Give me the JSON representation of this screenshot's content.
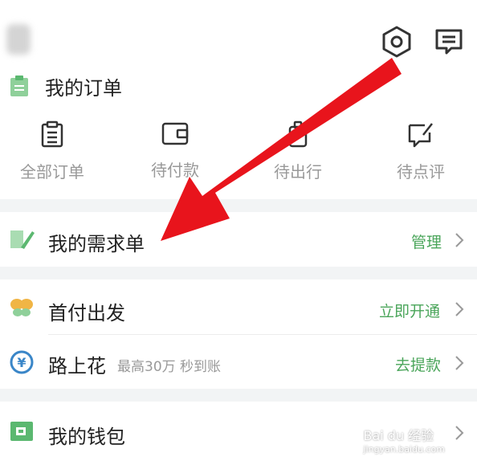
{
  "orders": {
    "title": "我的订单",
    "items": [
      {
        "label": "全部订单",
        "icon": "clipboard-icon"
      },
      {
        "label": "待付款",
        "icon": "wallet-icon"
      },
      {
        "label": "待出行",
        "icon": "luggage-icon"
      },
      {
        "label": "待点评",
        "icon": "comment-edit-icon"
      }
    ]
  },
  "demand": {
    "label": "我的需求单",
    "action": "管理"
  },
  "finance": {
    "shoufu": {
      "label": "首付出发",
      "action": "立即开通"
    },
    "lushanghua": {
      "label": "路上花",
      "subtitle": "最高30万 秒到账",
      "action": "去提款"
    }
  },
  "wallet": {
    "label": "我的钱包"
  },
  "watermark": {
    "text": "Bai du 经验",
    "url": "jingyan.baidu.com"
  },
  "colors": {
    "accent": "#4aa55a",
    "arrow": "#e8141c",
    "icon_green": "#8fd09a"
  }
}
